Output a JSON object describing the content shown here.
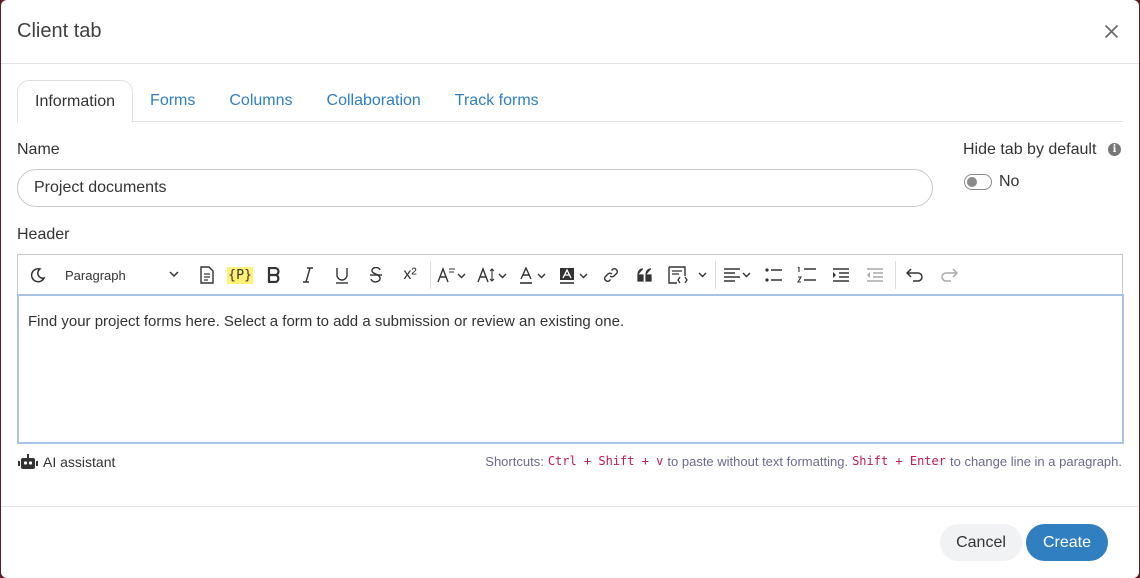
{
  "dialog": {
    "title": "Client tab",
    "close_label": "×"
  },
  "tabs": [
    {
      "label": "Information",
      "active": true
    },
    {
      "label": "Forms",
      "active": false
    },
    {
      "label": "Columns",
      "active": false
    },
    {
      "label": "Collaboration",
      "active": false
    },
    {
      "label": "Track forms",
      "active": false
    }
  ],
  "form": {
    "name_label": "Name",
    "name_value": "Project documents",
    "hide_tab_label": "Hide tab by default",
    "info_icon": "i",
    "toggle_state": "No",
    "header_label": "Header"
  },
  "toolbar": {
    "paragraph_label": "Paragraph",
    "placeholder_tag": "{P}",
    "superscript": "x²"
  },
  "editor": {
    "content": "Find your project forms here. Select a form to add a submission or review an existing one."
  },
  "assistant": {
    "label": "AI assistant"
  },
  "shortcuts": {
    "prefix": "Shortcuts:",
    "paste_keys": "Ctrl + Shift + v",
    "paste_text": "to paste without text formatting.",
    "newline_keys": "Shift + Enter",
    "newline_text": "to change line in a paragraph."
  },
  "footer": {
    "cancel_label": "Cancel",
    "create_label": "Create"
  },
  "colors": {
    "accent": "#2f7fc1",
    "kbd": "#c2185b",
    "placeholder_highlight": "#fff176"
  }
}
